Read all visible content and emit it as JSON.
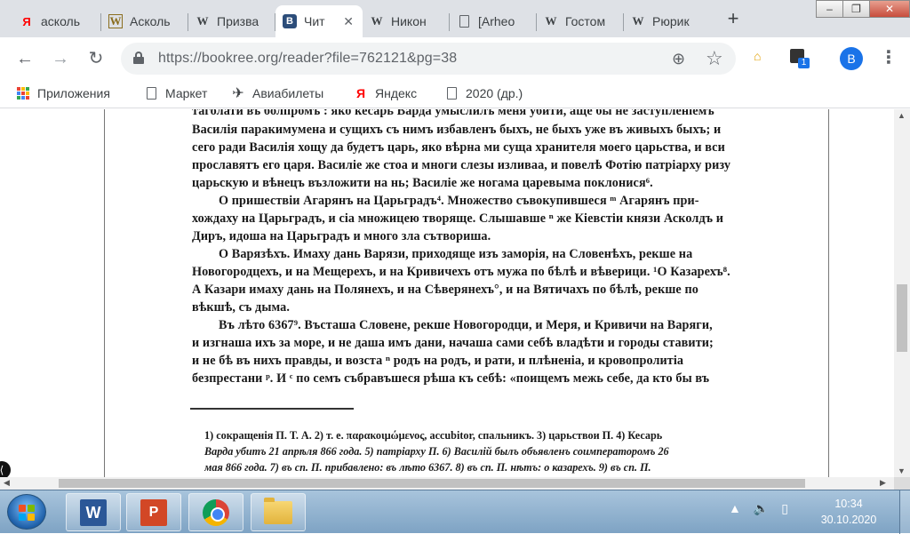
{
  "tabs": [
    {
      "label": "асколь",
      "favicon": "Я",
      "favicon_color": "#ff0000"
    },
    {
      "label": "Асколь",
      "favicon": "W",
      "favicon_color": "#8a6d1e"
    },
    {
      "label": "Призва",
      "favicon": "W",
      "favicon_color": "#222222"
    },
    {
      "label": "Чит",
      "favicon": "B",
      "favicon_color": "#2c4d7a",
      "close": "✕"
    },
    {
      "label": "Никон",
      "favicon": "W",
      "favicon_color": "#222222"
    },
    {
      "label": "[Arheo",
      "favicon": "doc",
      "favicon_color": "#5f6368"
    },
    {
      "label": "Гостом",
      "favicon": "W",
      "favicon_color": "#222222"
    },
    {
      "label": "Рюрик",
      "favicon": "W",
      "favicon_color": "#222222"
    }
  ],
  "newtab": "+",
  "window_buttons": {
    "minimize": "–",
    "maximize": "❐",
    "close": "✕"
  },
  "nav": {
    "back": "←",
    "forward": "→",
    "reload": "↻"
  },
  "address": {
    "url": "https://bookree.org/reader?file=762121&pg=38"
  },
  "toolbar_icons": {
    "zoom": "⊕",
    "star": "☆",
    "ext_badge": "1",
    "profile": "B",
    "menu": "⋮"
  },
  "bookmarks": [
    {
      "label": "Приложения",
      "icon": "apps-icon"
    },
    {
      "label": "Маркет",
      "icon": "page-icon"
    },
    {
      "label": "Авиабилеты",
      "icon": "plane-icon"
    },
    {
      "label": "Яндекс",
      "icon": "yandex-icon"
    },
    {
      "label": "2020 (др.)",
      "icon": "page-icon"
    }
  ],
  "document": {
    "lines": [
      "таголати въ болпромъ : яко кесарь Варда умыслилъ меня убити, аще бы не заступленіемъ",
      "Василія паракимумена и сущихъ съ нимъ избавленъ быхъ, не быхъ уже въ живыхъ быхъ; и",
      "сего ради Василія хощу да будетъ царь, яко вѣрна ми суща хранителя моего царьства, и вси",
      "прославятъ его царя. Василіе же стоа и многи слезы изливаа, и повелѣ Фотію патріарху ризу",
      "царьскую и вѣнецъ възложити на нь; Василіе же ногама царевыма поклонися⁶.",
      "О пришествіи Агарянъ на Царьградъ⁴. Множество съвокупившеся ᵐ Агарянъ при-",
      "хождаху на Царьградъ, и сіа множицею творяще. Слышавше ⁿ же Кіевстіи князи Асколдъ и",
      "Диръ, идоша на Царьградъ и много зла сътвориша.",
      "О Варязѣхъ. Имаху дань Варязи, приходяще изъ заморія, на Словенѣхъ, рекше на",
      "Новогородцехъ, и на Мещерехъ, и на Кривичехъ отъ мужа по бѣлѣ и вѣверици. ¹О Казарехъ⁸.",
      "А Казари имаху дань на Полянехъ, и на Сѣверянехъ°, и на Вятичахъ по бѣлѣ, рекше по",
      "вѣкшѣ, съ дыма.",
      "Въ лѣто 6367⁹. Въсташа Словене, рекше Новогородци, и Меря, и Кривичи на Варяги,",
      "и изгнаша ихъ за море, и не даша имъ дани, начаша сами себѣ владѣти и городы ставити;",
      "и не бѣ въ нихъ правды, и возста ⁿ родъ на родъ, и рати, и плѣненіа, и кровопролитіа",
      "безпрестани ᵖ. И ᶜ по семъ събравъшеся рѣша къ себѣ: «поищемъ межь себе, да кто бы въ"
    ],
    "footnotes": [
      "1) сокращенія П. Т. А.   2) т. е. παρακοιμώμενος, accubitor, спальникъ.   3) царьствои П.   4) Кесарь",
      "Варда убитъ 21 апрѣля 866 года.   5) патріарху П.   6) Василій былъ объявленъ соимператоромъ 26",
      "мая 866 года.   7) въ сп. П. прибавлено: въ лѣто 6367.   8) въ сп. П. нѣтъ: о казарехъ.   9) въ сп. П."
    ]
  },
  "taskbar": {
    "apps": [
      "word-icon",
      "powerpoint-icon",
      "chrome-icon",
      "explorer-icon"
    ],
    "time": "10:34",
    "date": "30.10.2020"
  }
}
